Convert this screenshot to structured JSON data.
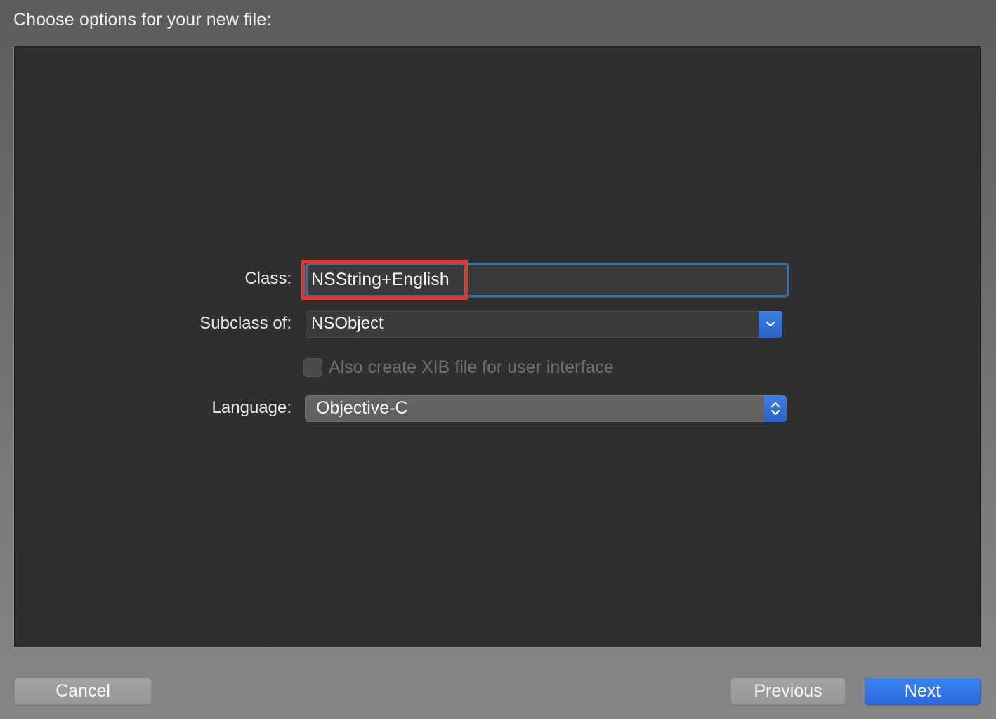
{
  "header": {
    "title": "Choose options for your new file:"
  },
  "form": {
    "class_label": "Class:",
    "class_value": "NSString+English",
    "subclass_label": "Subclass of:",
    "subclass_value": "NSObject",
    "xib_checkbox_label": "Also create XIB file for user interface",
    "xib_checked": false,
    "language_label": "Language:",
    "language_value": "Objective-C"
  },
  "footer": {
    "cancel_label": "Cancel",
    "previous_label": "Previous",
    "next_label": "Next"
  },
  "colors": {
    "accent_blue": "#2a6ae0",
    "highlight_red": "#e4392a",
    "panel_bg": "#2f2f2f"
  },
  "icons": {
    "subclass_dropdown": "chevron-down-icon",
    "language_stepper": "up-down-chevron-icon"
  }
}
